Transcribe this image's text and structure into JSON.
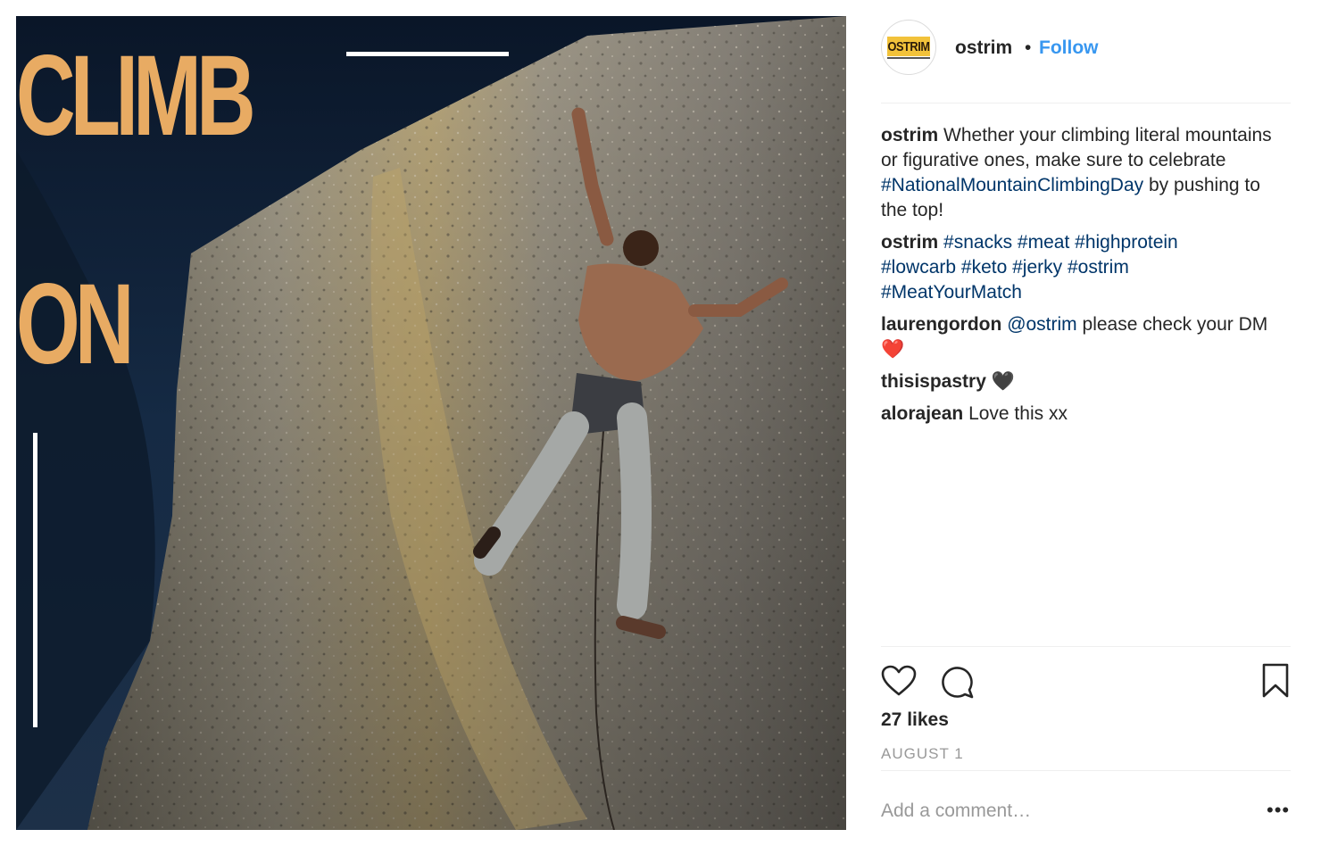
{
  "post": {
    "overlay_word_1": "CLIMB",
    "overlay_word_2": "ON",
    "overlay_color": "#e8ab63"
  },
  "header": {
    "avatar_text": "OSTRIM",
    "username": "ostrim",
    "separator": "•",
    "follow_label": "Follow"
  },
  "caption": {
    "user": "ostrim",
    "text": "Whether your climbing literal mountains or figurative ones, make sure to celebrate",
    "hashtag": "#NationalMountainClimbingDay",
    "text_end": "by pushing to the top!"
  },
  "tags_comment": {
    "user": "ostrim",
    "tags": [
      "#snacks",
      "#meat",
      "#highprotein",
      "#lowcarb",
      "#keto",
      "#jerky",
      "#ostrim",
      "#MeatYourMatch"
    ]
  },
  "comments": [
    {
      "user": "laurengordon",
      "mention": "@ostrim",
      "text": "please check your DM",
      "emoji": "❤️"
    },
    {
      "user": "thisispastry",
      "text": "",
      "emoji": "🖤"
    },
    {
      "user": "alorajean",
      "text": "Love this xx",
      "emoji": ""
    }
  ],
  "actions": {
    "icons": [
      "heart-icon",
      "comment-icon",
      "bookmark-icon"
    ],
    "likes": "27 likes",
    "date": "AUGUST 1",
    "comment_placeholder": "Add a comment…",
    "more": "•••"
  },
  "colors": {
    "link": "#3897f0",
    "hashtag": "#003569",
    "muted": "#999999"
  }
}
